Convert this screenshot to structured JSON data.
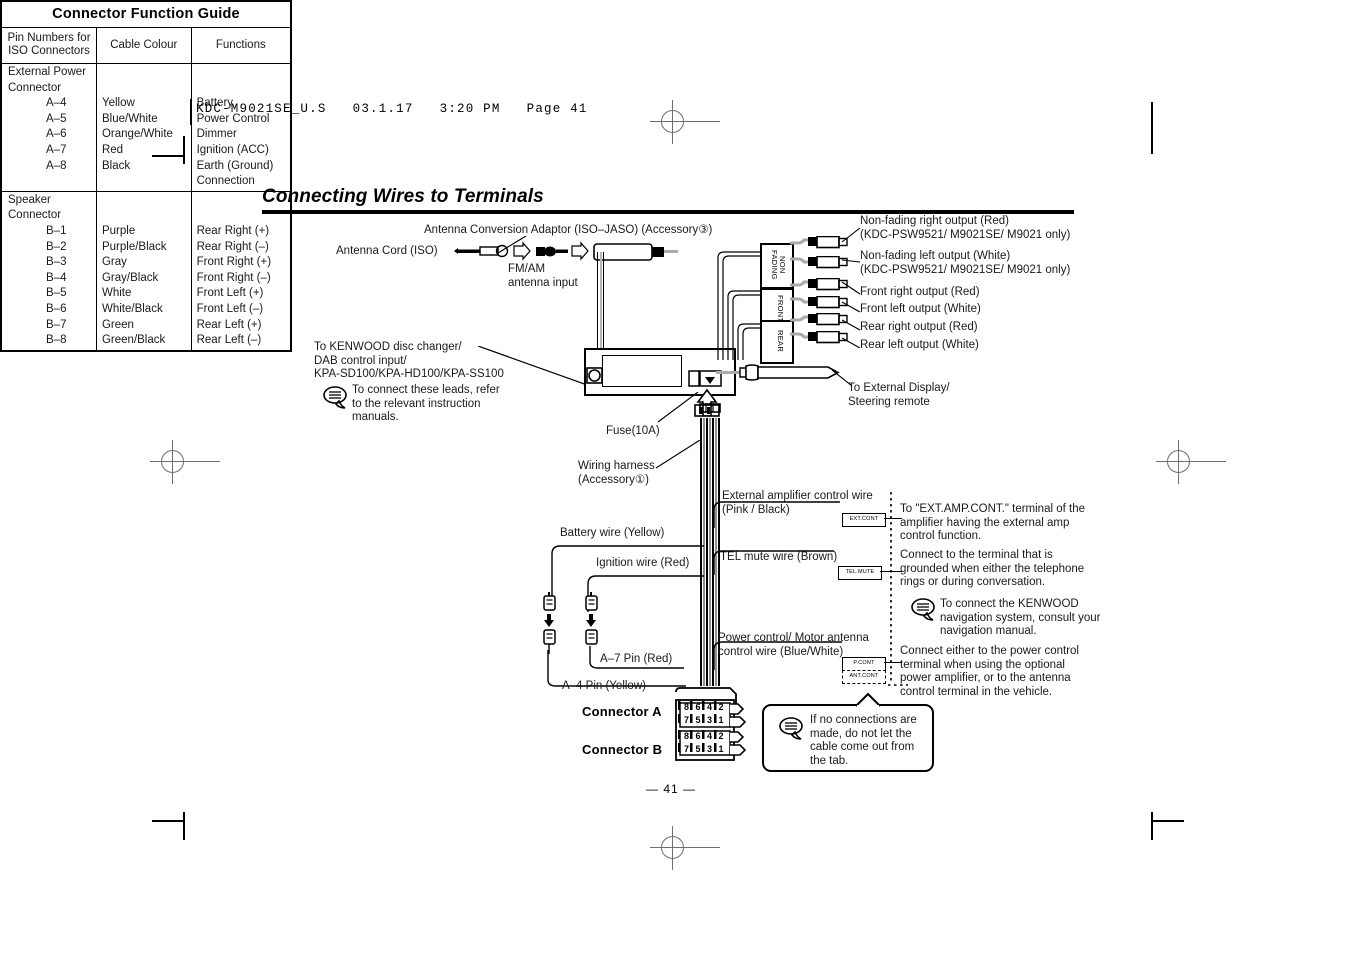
{
  "print_header": "KDC-M9021SE_U.S   03.1.17   3:20 PM   Page 41",
  "page_title": "Connecting Wires to Terminals",
  "page_number": "— 41 —",
  "table": {
    "title": "Connector Function Guide",
    "headers": [
      "Pin Numbers for\nISO Connectors",
      "Cable Colour",
      "Functions"
    ],
    "section1": {
      "name": "External Power\nConnector",
      "rows": [
        {
          "pin": "A–4",
          "colour": "Yellow",
          "function": "Battery"
        },
        {
          "pin": "A–5",
          "colour": "Blue/White",
          "function": "Power Control"
        },
        {
          "pin": "A–6",
          "colour": "Orange/White",
          "function": "Dimmer"
        },
        {
          "pin": "A–7",
          "colour": "Red",
          "function": "Ignition (ACC)"
        },
        {
          "pin": "A–8",
          "colour": "Black",
          "function": "Earth (Ground)\nConnection"
        }
      ]
    },
    "section2": {
      "name": "Speaker\nConnector",
      "rows": [
        {
          "pin": "B–1",
          "colour": "Purple",
          "function": "Rear Right (+)"
        },
        {
          "pin": "B–2",
          "colour": "Purple/Black",
          "function": "Rear Right (–)"
        },
        {
          "pin": "B–3",
          "colour": "Gray",
          "function": "Front Right (+)"
        },
        {
          "pin": "B–4",
          "colour": "Gray/Black",
          "function": "Front Right (–)"
        },
        {
          "pin": "B–5",
          "colour": "White",
          "function": "Front Left (+)"
        },
        {
          "pin": "B–6",
          "colour": "White/Black",
          "function": "Front Left (–)"
        },
        {
          "pin": "B–7",
          "colour": "Green",
          "function": "Rear Left (+)"
        },
        {
          "pin": "B–8",
          "colour": "Green/Black",
          "function": "Rear Left (–)"
        }
      ]
    }
  },
  "diagram": {
    "antenna_cord": "Antenna Cord (ISO)",
    "antenna_adaptor": "Antenna Conversion Adaptor (ISO–JASO) (Accessory③)",
    "fm_am_input": "FM/AM\nantenna input",
    "disc_changer": "To KENWOOD disc changer/\nDAB control input/\nKPA-SD100/KPA-HD100/KPA-SS100",
    "disc_changer_note": "To connect these leads, refer\nto the relevant instruction\nmanuals.",
    "outputs": [
      "Non-fading right output (Red)\n(KDC-PSW9521/ M9021SE/ M9021 only)",
      "Non-fading left output (White)\n(KDC-PSW9521/ M9021SE/ M9021 only)",
      "Front right output (Red)",
      "Front left output (White)",
      "Rear right output (Red)",
      "Rear left output (White)"
    ],
    "group_labels": [
      "NON\nFADING",
      "FRONT",
      "REAR"
    ],
    "external_display": "To External Display/\nSteering remote",
    "fuse": "Fuse(10A)",
    "wiring_harness": "Wiring harness\n(Accessory①)",
    "battery_wire": "Battery wire (Yellow)",
    "ignition_wire": "Ignition wire (Red)",
    "ext_amp_wire": "External amplifier control wire\n(Pink / Black)",
    "tel_mute_wire": "TEL mute wire (Brown)",
    "power_control_wire": "Power control/ Motor antenna\ncontrol wire (Blue/White)",
    "tags": [
      "EXT.CONT",
      "TEL.MUTE",
      "P.CONT",
      "ANT.CONT"
    ],
    "pin_a7": "A–7 Pin (Red)",
    "pin_a4": "A–4 Pin (Yellow)",
    "connector_a": "Connector A",
    "connector_b": "Connector B",
    "connector_pins_top": "8  6  4  2",
    "connector_pins_bottom": "7  5  3  1",
    "tab_note": "If no connections are\nmade, do not let the\ncable come out from\nthe tab.",
    "notes": [
      "To \"EXT.AMP.CONT.\" terminal of the\namplifier having the external amp\ncontrol function.",
      "Connect to the terminal that is\ngrounded when either the telephone\nrings or during conversation.",
      "To connect the KENWOOD\nnavigation system, consult your\nnavigation manual.",
      "Connect either to the power control\nterminal when using the optional\npower amplifier, or to the antenna\ncontrol terminal in the vehicle."
    ]
  }
}
